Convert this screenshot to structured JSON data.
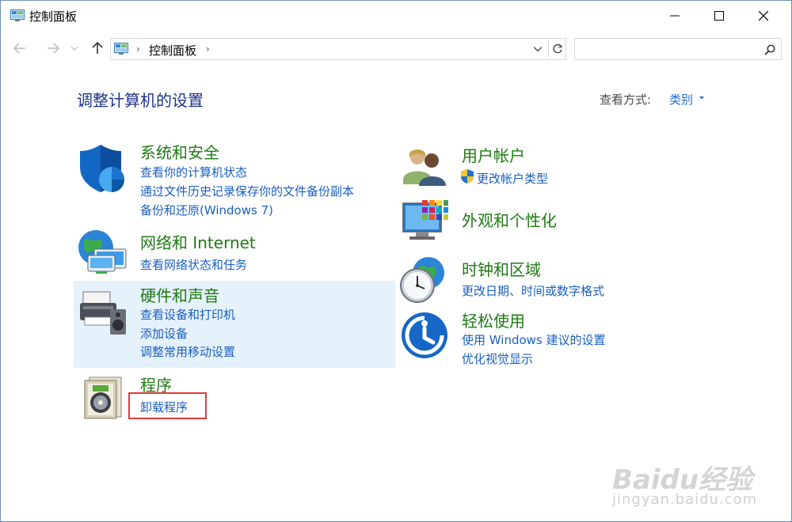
{
  "window": {
    "title": "控制面板",
    "minimize_icon": "minimize-icon",
    "maximize_icon": "maximize-icon",
    "close_icon": "close-icon"
  },
  "nav": {
    "address_path": "控制面板",
    "search_placeholder": "",
    "back_icon": "back-arrow-icon",
    "forward_icon": "forward-arrow-icon",
    "up_icon": "up-arrow-icon",
    "refresh_icon": "refresh-icon",
    "search_icon": "search-icon"
  },
  "main": {
    "heading": "调整计算机的设置",
    "view_by_label": "查看方式:",
    "view_by_value": "类别"
  },
  "categories": {
    "system": {
      "title": "系统和安全",
      "links": [
        "查看你的计算机状态",
        "通过文件历史记录保存你的文件备份副本",
        "备份和还原(Windows 7)"
      ]
    },
    "network": {
      "title": "网络和 Internet",
      "links": [
        "查看网络状态和任务"
      ]
    },
    "hardware": {
      "title": "硬件和声音",
      "links": [
        "查看设备和打印机",
        "添加设备",
        "调整常用移动设置"
      ]
    },
    "programs": {
      "title": "程序",
      "links": [
        "卸载程序"
      ]
    },
    "users": {
      "title": "用户帐户",
      "links": [
        "更改帐户类型"
      ]
    },
    "appearance": {
      "title": "外观和个性化",
      "links": []
    },
    "clock": {
      "title": "时钟和区域",
      "links": [
        "更改日期、时间或数字格式"
      ]
    },
    "ease": {
      "title": "轻松使用",
      "links": [
        "使用 Windows 建议的设置",
        "优化视觉显示"
      ]
    }
  },
  "watermark": {
    "logo": "Baidu经验",
    "url": "jingyan.baidu.com"
  },
  "colors": {
    "category_title": "#1e7a14",
    "link": "#1a5fc0",
    "heading": "#1e3287",
    "highlight": "#e5f1fb",
    "annotation_box": "#e03c3c"
  }
}
